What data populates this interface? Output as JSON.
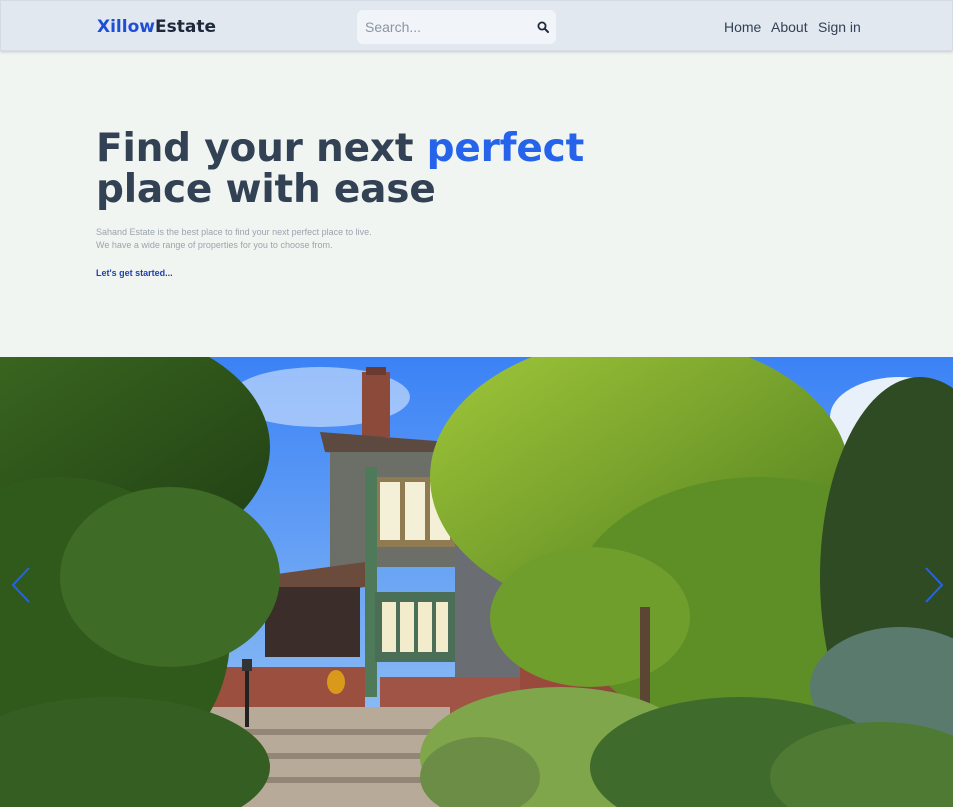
{
  "header": {
    "logo_part1": "Xillow",
    "logo_part2": "Estate",
    "search_placeholder": "Search...",
    "nav": [
      "Home",
      "About",
      "Sign in"
    ]
  },
  "hero": {
    "title_line1": "Find your next ",
    "title_accent": "perfect",
    "title_line2": "place with ease",
    "desc_line1": "Sahand Estate is the best place to find your next perfect place to live.",
    "desc_line2": "We have a wide range of properties for you to choose from.",
    "cta": "Let's get started..."
  },
  "slider": {
    "image": "house-photo",
    "prev_icon": "chevron-left-icon",
    "next_icon": "chevron-right-icon"
  },
  "colors": {
    "accent": "#2563eb",
    "heading": "#334155",
    "header_bg": "#e2e8f0",
    "page_bg": "#f1f5f1"
  }
}
